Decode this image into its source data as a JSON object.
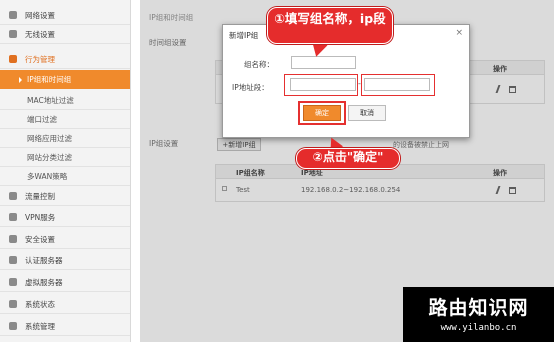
{
  "sidebar": {
    "items": [
      {
        "label": "网络设置",
        "kind": "group"
      },
      {
        "label": "无线设置",
        "kind": "group"
      },
      {
        "label": "行为管理",
        "kind": "group",
        "open": true
      },
      {
        "label": "IP组和时间组",
        "kind": "sub",
        "active": true
      },
      {
        "label": "MAC地址过滤",
        "kind": "sub"
      },
      {
        "label": "端口过滤",
        "kind": "sub"
      },
      {
        "label": "网络应用过滤",
        "kind": "sub"
      },
      {
        "label": "网站分类过滤",
        "kind": "sub"
      },
      {
        "label": "多WAN策略",
        "kind": "sub"
      },
      {
        "label": "流量控制",
        "kind": "group"
      },
      {
        "label": "VPN服务",
        "kind": "group"
      },
      {
        "label": "安全设置",
        "kind": "group"
      },
      {
        "label": "认证服务器",
        "kind": "group"
      },
      {
        "label": "虚拟服务器",
        "kind": "group"
      },
      {
        "label": "系统状态",
        "kind": "group"
      },
      {
        "label": "系统管理",
        "kind": "group"
      }
    ]
  },
  "content": {
    "heading": "IP组和时间组",
    "time_group_label": "时间组设置",
    "op_header_top": "操作",
    "ip_group_label": "IP组设置",
    "add_ip_group": "+新增IP组",
    "note_text": "的设备被禁止上网",
    "table": {
      "headers": [
        "IP组名称",
        "IP地址",
        "操作"
      ],
      "rows": [
        {
          "name": "Test",
          "range": "192.168.0.2~192.168.0.254"
        }
      ]
    }
  },
  "modal": {
    "title": "新增IP组",
    "close_glyph": "×",
    "name_label": "组名称：",
    "name_value": "",
    "range_label": "IP地址段：",
    "range_start_value": "",
    "range_sep": "-",
    "range_end_value": "",
    "ok": "确定",
    "cancel": "取消"
  },
  "callouts": {
    "step1": "①填写组名称，ip段",
    "step2": "②点击\"确定\""
  },
  "watermark": {
    "title": "路由知识网",
    "url": "www.yilanbo.cn"
  },
  "colors": {
    "accent": "#f08a2c",
    "callout": "#e52c2c"
  }
}
